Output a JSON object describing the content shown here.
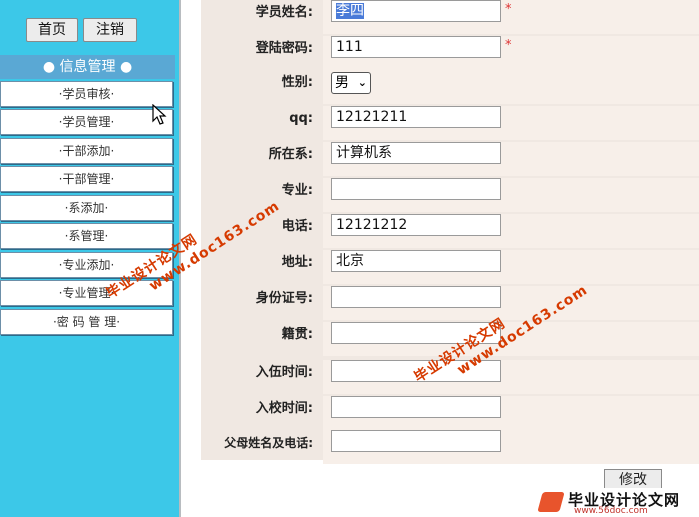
{
  "nav": {
    "home": "首页",
    "logout": "注销",
    "section_title": "● 信息管理 ●",
    "items": [
      {
        "label": "·学员审核·"
      },
      {
        "label": "·学员管理·"
      },
      {
        "label": "·干部添加·"
      },
      {
        "label": "·干部管理·"
      },
      {
        "label": "·系添加·"
      },
      {
        "label": "·系管理·"
      },
      {
        "label": "·专业添加·"
      },
      {
        "label": "·专业管理·"
      },
      {
        "label": "·密 码 管 理·"
      }
    ]
  },
  "form": {
    "fields": [
      {
        "label": "学员姓名:",
        "value": "李四",
        "required": "*"
      },
      {
        "label": "登陆密码:",
        "value": "111",
        "required": "*"
      },
      {
        "label": "性别:",
        "value": "男"
      },
      {
        "label": "qq:",
        "value": "12121211"
      },
      {
        "label": "所在系:",
        "value": "计算机系"
      },
      {
        "label": "专业:",
        "value": ""
      },
      {
        "label": "电话:",
        "value": "12121212"
      },
      {
        "label": "地址:",
        "value": "北京"
      },
      {
        "label": "身份证号:",
        "value": ""
      },
      {
        "label": "籍贯:",
        "value": ""
      },
      {
        "label": "入伍时间:",
        "value": ""
      },
      {
        "label": "入校时间:",
        "value": ""
      },
      {
        "label": "父母姓名及电话:",
        "value": ""
      }
    ],
    "submit": "修改"
  },
  "watermark": {
    "line1": "毕业设计论文网",
    "line2": "www.doc163.com"
  },
  "logo": {
    "title": "毕业设计论文网",
    "url": "www.56doc.com"
  },
  "colors": {
    "sidebar": "#3cc8e8",
    "menu_header": "#5aa8d4",
    "form_bg": "#f0e8e2",
    "required": "#dd3333",
    "watermark": "#d63a00"
  }
}
